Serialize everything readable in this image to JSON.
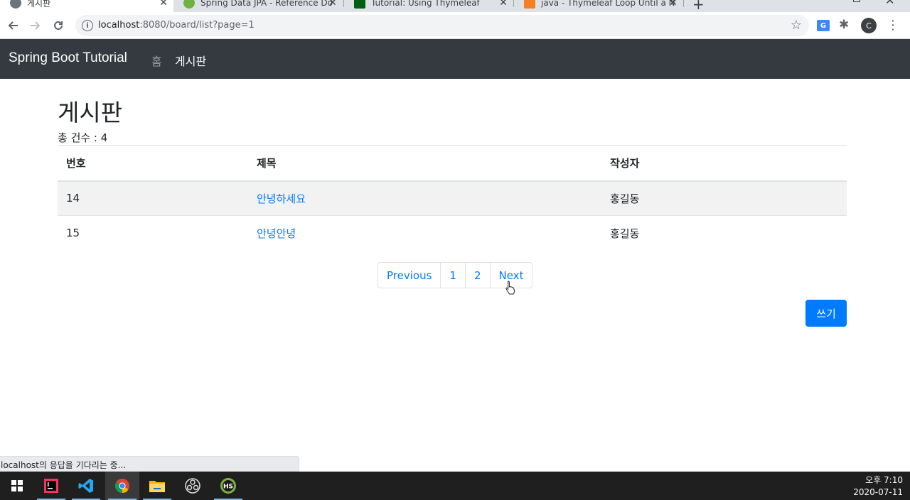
{
  "browser": {
    "tabs": [
      {
        "title": "게시판",
        "active": true
      },
      {
        "title": "Spring Data JPA - Reference Do",
        "active": false
      },
      {
        "title": "Tutorial: Using Thymeleaf",
        "active": false
      },
      {
        "title": "java - Thymeleaf Loop Until a N",
        "active": false
      }
    ],
    "address": {
      "host": "localhost",
      "rest": ":8080/board/list?page=1"
    },
    "profile_initial": "C",
    "status_text": "localhost의 응답을 기다리는 중..."
  },
  "navbar": {
    "brand": "Spring Boot Tutorial",
    "links": [
      {
        "label": "홈",
        "active": false
      },
      {
        "label": "게시판",
        "active": true
      }
    ]
  },
  "board": {
    "heading": "게시판",
    "total_label": "총 건수 : 4",
    "columns": [
      "번호",
      "제목",
      "작성자"
    ],
    "rows": [
      {
        "id": "14",
        "title": "안녕하세요",
        "author": "홍길동"
      },
      {
        "id": "15",
        "title": "안녕안녕",
        "author": "홍길동"
      }
    ],
    "pagination": {
      "previous": "Previous",
      "pages": [
        "1",
        "2"
      ],
      "next": "Next"
    },
    "write_button": "쓰기"
  },
  "taskbar": {
    "time": "오후 7:10",
    "date": "2020-07-11",
    "apps": [
      "intellij-icon",
      "vscode-icon",
      "chrome-icon",
      "file-explorer-icon",
      "obs-icon",
      "hs-app-icon"
    ]
  },
  "colors": {
    "navbar_bg": "#343a40",
    "link": "#007bff",
    "primary_button": "#007bff",
    "table_stripe": "#f2f2f2"
  }
}
